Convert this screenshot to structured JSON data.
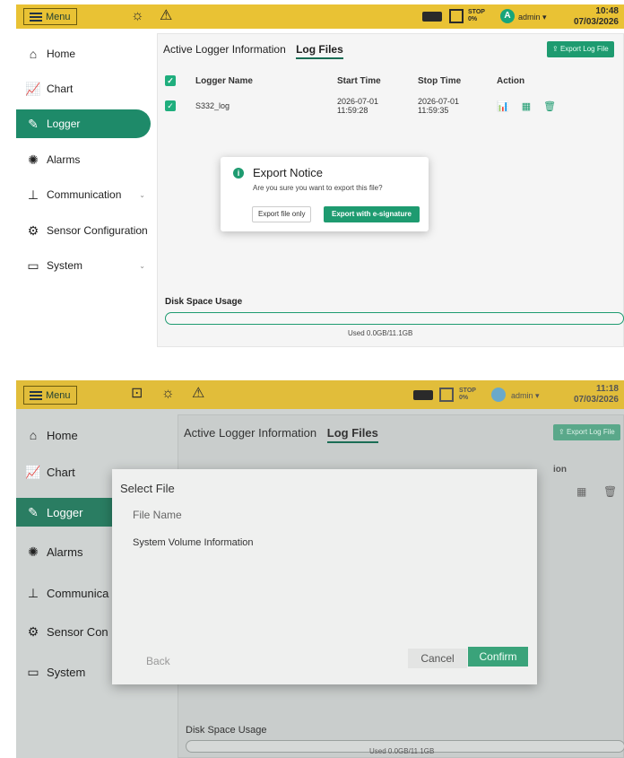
{
  "colors": {
    "topbar": "#e9c234",
    "accent": "#1e9b70",
    "sidebar_active": "#1e8a69"
  },
  "top_panel": {
    "topbar": {
      "menu_label": "Menu",
      "stop_label": "STOP",
      "stop_percent": "0%",
      "avatar_letter": "A",
      "user": "admin",
      "time": "10:48",
      "date": "07/03/2026"
    },
    "sidebar": [
      {
        "label": "Home",
        "icon": "home-icon"
      },
      {
        "label": "Chart",
        "icon": "chart-icon"
      },
      {
        "label": "Logger",
        "icon": "logger-icon"
      },
      {
        "label": "Alarms",
        "icon": "alarm-icon"
      },
      {
        "label": "Communication",
        "icon": "network-icon"
      },
      {
        "label": "Sensor Configuration",
        "icon": "gear-icon"
      },
      {
        "label": "System",
        "icon": "monitor-icon"
      }
    ],
    "tabs": {
      "inactive": "Active Logger Information",
      "active": "Log Files"
    },
    "export_button": "Export Log File",
    "table": {
      "headers": {
        "name": "Logger Name",
        "start": "Start Time",
        "stop": "Stop Time",
        "action": "Action"
      },
      "rows": [
        {
          "name": "S332_log",
          "start_date": "2026-07-01",
          "start_time": "11:59:28",
          "stop_date": "2026-07-01",
          "stop_time": "11:59:35"
        }
      ]
    },
    "dialog": {
      "title": "Export Notice",
      "message": "Are you sure you want to export this file?",
      "btn_secondary": "Export file only",
      "btn_primary": "Export with e-signature"
    },
    "disk": {
      "label": "Disk Space Usage",
      "used_text": "Used 0.0GB/11.1GB"
    }
  },
  "bottom_panel": {
    "topbar": {
      "menu_label": "Menu",
      "stop_label": "STOP",
      "stop_percent": "0%",
      "user": "admin",
      "time": "11:18",
      "date": "07/03/2026"
    },
    "sidebar": [
      {
        "label": "Home"
      },
      {
        "label": "Chart"
      },
      {
        "label": "Logger"
      },
      {
        "label": "Alarms"
      },
      {
        "label": "Communica"
      },
      {
        "label": "Sensor Con"
      },
      {
        "label": "System"
      }
    ],
    "tabs": {
      "inactive": "Active Logger Information",
      "active": "Log Files"
    },
    "export_button": "Export Log File",
    "peek_header": "ion",
    "dialog": {
      "title": "Select File",
      "column_header": "File Name",
      "files": [
        "System Volume Information"
      ],
      "back": "Back",
      "cancel": "Cancel",
      "confirm": "Confirm"
    },
    "disk": {
      "label": "Disk Space Usage",
      "used_text": "Used 0.0GB/11.1GB"
    }
  }
}
